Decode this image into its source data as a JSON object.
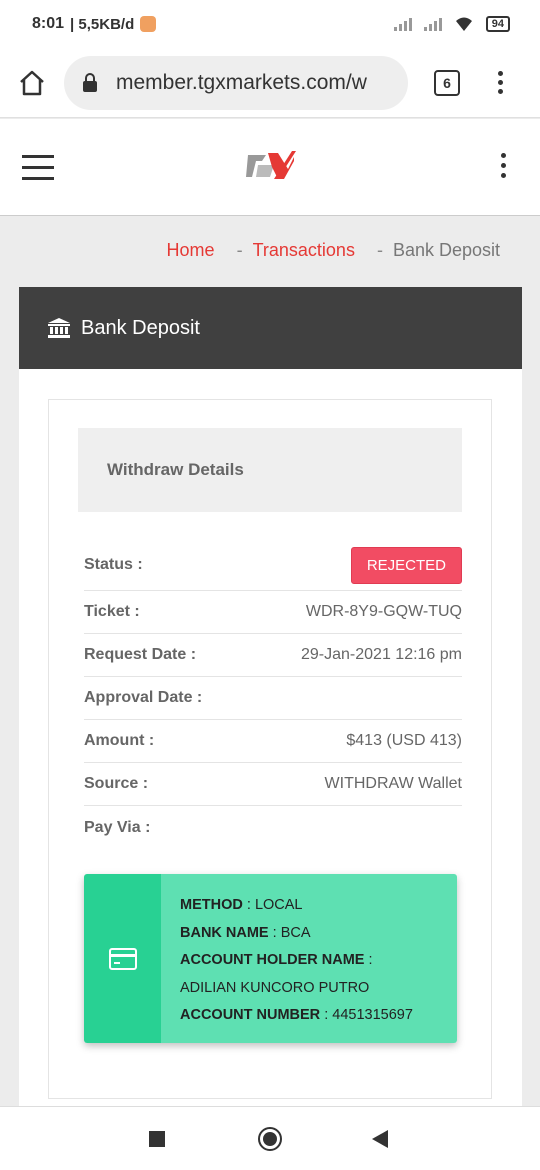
{
  "status_bar": {
    "time": "8:01",
    "speed": "| 5,5KB/d",
    "battery": "94"
  },
  "browser": {
    "url": "member.tgxmarkets.com/w",
    "tab_count": "6"
  },
  "breadcrumb": {
    "home": "Home",
    "sep1": "-",
    "transactions": "Transactions",
    "sep2": "-",
    "current": "Bank Deposit"
  },
  "card": {
    "title": "Bank Deposit",
    "section_title": "Withdraw Details"
  },
  "details": {
    "status_label": "Status :",
    "status_value": "REJECTED",
    "ticket_label": "Ticket :",
    "ticket_value": "WDR-8Y9-GQW-TUQ",
    "request_label": "Request Date :",
    "request_value": "29-Jan-2021 12:16 pm",
    "approval_label": "Approval Date :",
    "approval_value": "",
    "amount_label": "Amount :",
    "amount_value": "$413 (USD 413)",
    "source_label": "Source :",
    "source_value": "WITHDRAW Wallet",
    "payvia_label": "Pay Via :"
  },
  "payment": {
    "method_label": "METHOD",
    "method_value": "LOCAL",
    "bank_label": "BANK NAME",
    "bank_value": "BCA",
    "holder_label": "ACCOUNT HOLDER NAME",
    "holder_value": "ADILIAN KUNCORO PUTRO",
    "number_label": "ACCOUNT NUMBER",
    "number_value": "4451315697"
  },
  "colors": {
    "accent_red": "#e53935",
    "header_dark": "#404040",
    "badge_red": "#f24c63",
    "pay_green": "#5ee0b2",
    "pay_green_dark": "#28d193"
  },
  "icons": [
    "home-icon",
    "lock-icon",
    "bank-icon",
    "credit-card-icon",
    "wifi-icon",
    "signal-icon"
  ]
}
